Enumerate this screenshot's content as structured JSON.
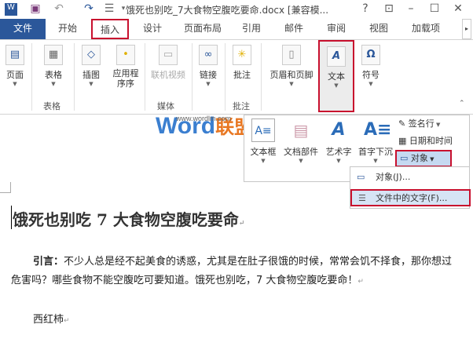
{
  "title_bar": {
    "title": "饿死也别吃_7大食物空腹吃要命.docx [兼容模...",
    "icons": [
      "word-icon",
      "save-icon",
      "undo-icon",
      "redo-icon",
      "touch-mode-icon",
      "customize-icon",
      "help-icon",
      "ribbon-display-icon",
      "minimize-icon",
      "maximize-icon",
      "close-icon"
    ],
    "help": "?",
    "close": "✕"
  },
  "tabs": [
    "文件",
    "开始",
    "插入",
    "设计",
    "页面布局",
    "引用",
    "邮件",
    "审阅",
    "视图",
    "加载项"
  ],
  "ribbon": {
    "buttons": [
      {
        "label": "页面"
      },
      {
        "label": "表格"
      },
      {
        "label": "插图"
      },
      {
        "label": "应用程序序"
      },
      {
        "label": "联机视频"
      },
      {
        "label": "链接"
      },
      {
        "label": "批注"
      },
      {
        "label": "页眉和页脚"
      },
      {
        "label": "文本"
      },
      {
        "label": "符号"
      }
    ],
    "groups": [
      "表格",
      "媒体",
      "批注"
    ]
  },
  "text_gallery": {
    "items": [
      "文本框",
      "文档部件",
      "艺术字",
      "首字下沉"
    ],
    "side": [
      "签名行",
      "日期和时间",
      "对象"
    ]
  },
  "object_menu": [
    "对象(J)...",
    "文件中的文字(F)..."
  ],
  "watermark": {
    "brand": "Word",
    "brand_cn": "联盟",
    "url": "www.wordlm.com"
  },
  "document": {
    "heading": "饿死也别吃 7 大食物空腹吃要命",
    "intro_label": "引言：",
    "intro_text": "不少人总是经不起美食的诱惑，尤其是在肚子很饿的时候，常常会饥不择食，那你想过危害吗？哪些食物不能空腹吃可要知道。饿死也别吃，7 大食物空腹吃要命！",
    "item1": "西红柿"
  },
  "colors": {
    "accent": "#2b579a",
    "highlight": "#c8102e"
  }
}
